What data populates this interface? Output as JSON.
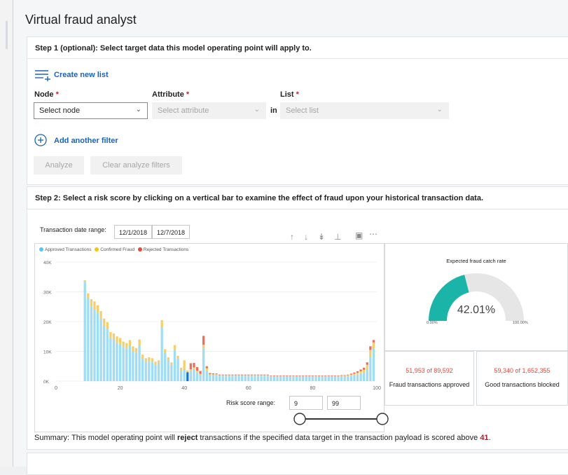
{
  "page": {
    "title": "Virtual fraud analyst"
  },
  "step1": {
    "heading": "Step 1 (optional): Select target data this model operating point will apply to.",
    "create_link": "Create new list",
    "node": {
      "label": "Node",
      "value": "Select node"
    },
    "attribute": {
      "label": "Attribute",
      "placeholder": "Select attribute"
    },
    "in_label": "in",
    "list": {
      "label": "List",
      "placeholder": "Select list"
    },
    "required_mark": "*",
    "add_filter": "Add another filter",
    "analyze_button": "Analyze",
    "clear_button": "Clear analyze filters"
  },
  "step2": {
    "heading": "Step 2: Select a risk score by clicking on a vertical bar to examine the effect of fraud upon your historical transaction data.",
    "date_range_label": "Transaction date range:",
    "date_start": "12/1/2018",
    "date_end": "12/7/2018",
    "toolbar_icons": [
      "arrow-up-icon",
      "arrow-down-icon",
      "double-arrow-down-icon",
      "hierarchy-icon",
      "focus-mode-icon",
      "more-options-icon"
    ],
    "risk_range_label": "Risk score range:",
    "risk_min": "9",
    "risk_max": "99",
    "gauge": {
      "title": "Expected fraud catch rate",
      "value": 42.01,
      "value_label": "42.01%",
      "min_label": "0.00%",
      "max_label": "100.00%",
      "fill_color": "#1ab5a8",
      "track_color": "#e6e6e6"
    },
    "stats": [
      {
        "value": "51,953 of 89,592",
        "label": "Fraud transactions approved"
      },
      {
        "value": "59,340 of 1,652,355",
        "label": "Good transactions blocked"
      }
    ],
    "summary": {
      "prefix": "Summary: This model operating point will ",
      "action": "reject",
      "middle": " transactions if the specified data target in the transaction payload is scored above ",
      "threshold": "41",
      "suffix": "."
    }
  },
  "colors": {
    "approved": "#9fdcf5",
    "fraud": "#f5cf6b",
    "rejected": "#ef6c5f",
    "selected": "#1a72c8",
    "accent": "#1a63b8"
  },
  "chart_data": {
    "type": "bar",
    "stacked": true,
    "title": "",
    "xlabel": "",
    "ylabel": "",
    "legend": [
      "Approved Transactions",
      "Confirmed Fraud",
      "Rejected Transactions"
    ],
    "legend_position": "top-left",
    "x_ticks": [
      0,
      20,
      40,
      60,
      80,
      100
    ],
    "y_ticks": [
      "0K",
      "10K",
      "20K",
      "30K",
      "40K"
    ],
    "xlim": [
      0,
      100
    ],
    "ylim": [
      0,
      40000
    ],
    "selected_score": 41,
    "x": [
      9,
      10,
      11,
      12,
      13,
      14,
      15,
      16,
      17,
      18,
      19,
      20,
      21,
      22,
      23,
      24,
      25,
      26,
      27,
      28,
      29,
      30,
      31,
      32,
      33,
      34,
      35,
      36,
      37,
      38,
      39,
      40,
      41,
      42,
      43,
      44,
      45,
      46,
      47,
      48,
      49,
      50,
      51,
      52,
      53,
      54,
      55,
      56,
      57,
      58,
      59,
      60,
      61,
      62,
      63,
      64,
      65,
      66,
      67,
      68,
      69,
      70,
      71,
      72,
      73,
      74,
      75,
      76,
      77,
      78,
      79,
      80,
      81,
      82,
      83,
      84,
      85,
      86,
      87,
      88,
      89,
      90,
      91,
      92,
      93,
      94,
      95,
      96,
      97,
      98,
      99
    ],
    "series": [
      {
        "name": "Approved Transactions",
        "values": [
          33500,
          28000,
          25000,
          24000,
          23000,
          21000,
          18500,
          17500,
          14500,
          14000,
          13000,
          12500,
          11500,
          11000,
          12000,
          10000,
          9500,
          12000,
          7500,
          6500,
          6800,
          6500,
          5500,
          6000,
          18000,
          9500,
          7000,
          5500,
          10500,
          7500,
          3500,
          4000,
          3000,
          3500,
          4000,
          3000,
          2000,
          11000,
          3500,
          2000,
          2000,
          2000,
          1800,
          1800,
          1800,
          1800,
          1800,
          1800,
          1800,
          1800,
          1800,
          1800,
          1800,
          1800,
          1800,
          1800,
          1800,
          1800,
          1500,
          1500,
          1500,
          1500,
          1500,
          1500,
          1500,
          1500,
          1500,
          1500,
          1500,
          1500,
          1500,
          1500,
          1500,
          1500,
          1500,
          1500,
          1500,
          1500,
          1500,
          1500,
          1600,
          1600,
          1700,
          1800,
          2000,
          2200,
          2500,
          2800,
          4000,
          8000,
          11000
        ]
      },
      {
        "name": "Confirmed Fraud",
        "values": [
          400,
          1500,
          2500,
          2800,
          2500,
          2500,
          2500,
          2300,
          2000,
          2000,
          2000,
          2000,
          1800,
          1800,
          1800,
          1700,
          1600,
          2000,
          1400,
          1200,
          1200,
          1200,
          1000,
          1000,
          2500,
          1200,
          1000,
          800,
          1600,
          1000,
          1000,
          3000,
          600,
          500,
          600,
          500,
          400,
          1200,
          800,
          300,
          300,
          300,
          200,
          200,
          200,
          200,
          200,
          200,
          200,
          200,
          200,
          200,
          200,
          200,
          200,
          200,
          200,
          200,
          200,
          200,
          200,
          200,
          200,
          200,
          200,
          200,
          200,
          200,
          200,
          200,
          200,
          200,
          200,
          200,
          200,
          200,
          200,
          200,
          200,
          200,
          200,
          200,
          300,
          400,
          500,
          600,
          800,
          1000,
          1500,
          2500,
          2000
        ]
      },
      {
        "name": "Rejected Transactions",
        "values": [
          0,
          0,
          0,
          0,
          0,
          0,
          0,
          0,
          0,
          0,
          0,
          0,
          0,
          0,
          0,
          0,
          0,
          0,
          0,
          0,
          0,
          0,
          0,
          0,
          0,
          0,
          0,
          0,
          0,
          0,
          0,
          0,
          0,
          2000,
          1500,
          1200,
          1000,
          3000,
          700,
          400,
          300,
          250,
          200,
          200,
          200,
          200,
          200,
          200,
          200,
          200,
          200,
          200,
          200,
          200,
          200,
          200,
          200,
          200,
          200,
          200,
          200,
          200,
          200,
          200,
          200,
          200,
          200,
          200,
          200,
          200,
          200,
          200,
          200,
          200,
          200,
          200,
          200,
          200,
          200,
          200,
          200,
          200,
          200,
          300,
          400,
          500,
          600,
          700,
          800,
          1200,
          800
        ]
      }
    ]
  }
}
